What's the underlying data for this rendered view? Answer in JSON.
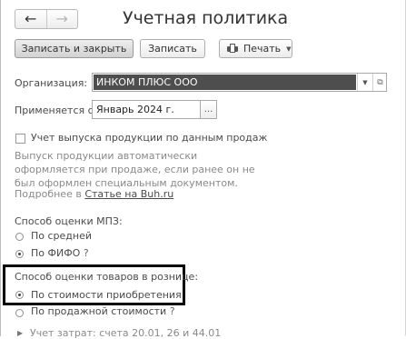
{
  "window": {
    "title": "Учетная политика"
  },
  "nav": {
    "back": "←",
    "forward": "→"
  },
  "toolbar": {
    "save_close_label": "Записать и закрыть",
    "save_label": "Записать",
    "print_label": "Печать"
  },
  "form": {
    "org_label": "Организация:",
    "org_value": "ИНКОМ ПЛЮС ООО",
    "applies_label": "Применяется с:",
    "applies_value": "Январь 2024 г.",
    "date_pick_label": "...",
    "production_checkbox_label": "Учет выпуска продукции по данным продаж",
    "production_checkbox_checked": false,
    "hint_text": "Выпуск продукции автоматически оформляется при продаже, если ранее он не был оформлен специальным документом.",
    "more_prefix": "Подробнее в",
    "more_link": "Статье на Buh.ru",
    "mpz_section_label": "Способ оценки МПЗ:",
    "mpz_options": [
      {
        "label": "По средней",
        "selected": false
      },
      {
        "label": "По ФИФО",
        "selected": true,
        "help": "?"
      }
    ],
    "retail_section_label": "Способ оценки товаров в рознице:",
    "retail_options": [
      {
        "label": "По стоимости приобретения",
        "selected": true
      },
      {
        "label": "По продажной стоимости",
        "selected": false,
        "help": "?"
      }
    ],
    "cut_off_text": "Учет затрат: счета 20.01, 26 и 44.01"
  },
  "icons": {
    "print": "printer-icon",
    "dropdown": "chevron-down-icon",
    "open": "open-icon",
    "expand": "chevron-right-icon"
  },
  "colors": {
    "selection_bg": "#4e4e4e",
    "highlight_border": "#000000"
  }
}
